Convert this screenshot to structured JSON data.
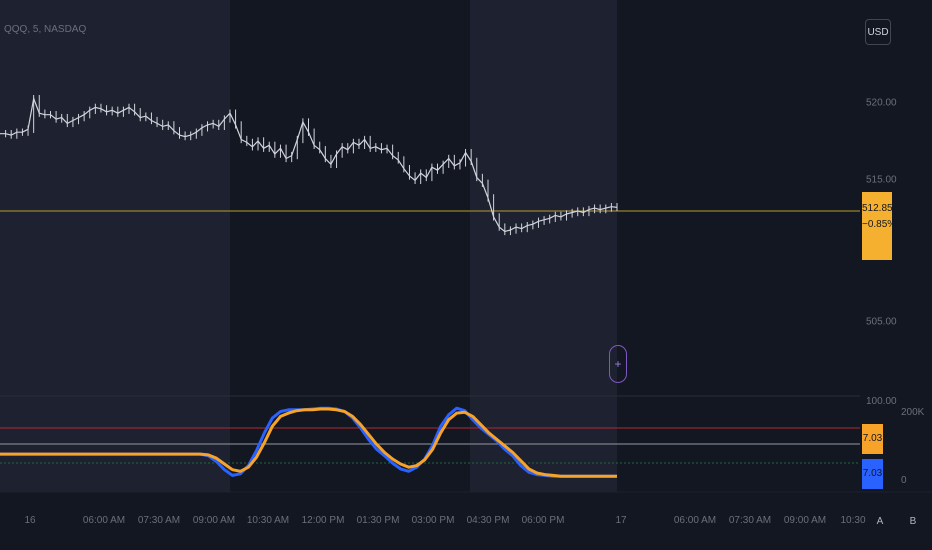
{
  "symbol": {
    "title": "QQQ, 5, NASDAQ"
  },
  "toolbar": {
    "currency": "USD"
  },
  "price_axis": {
    "labels": [
      "520.00",
      "515.00",
      "505.00"
    ],
    "current_price": "512.85",
    "current_change": "−0.85%"
  },
  "oscillator": {
    "axis_top": "100.00",
    "axis_volume": "200K",
    "axis_zero": "0",
    "badge_orange": "7.03",
    "badge_blue": "7.03",
    "colors": {
      "fast": "#2962ff",
      "slow": "#f7a32a",
      "upper": "#b22833",
      "mid": "#9598a1",
      "lower": "#1b6b3a"
    }
  },
  "time_axis": {
    "labels": [
      "16",
      "06:00 AM",
      "07:30 AM",
      "09:00 AM",
      "10:30 AM",
      "12:00 PM",
      "01:30 PM",
      "03:00 PM",
      "04:30 PM",
      "06:00 PM",
      "17",
      "06:00 AM",
      "07:30 AM",
      "09:00 AM",
      "10:30"
    ],
    "btn_a": "A",
    "btn_b": "B"
  },
  "colors": {
    "background": "#131722",
    "session_shade": "#1e2130",
    "price_line": "#b89b2f",
    "candles": "#d1d4dc",
    "badge": "#f5b02f"
  },
  "chart_data": {
    "type": "line",
    "price_series": {
      "name": "QQQ",
      "y_range": [
        502,
        524
      ],
      "values": [
        517.9,
        517.9,
        517.8,
        518.0,
        518.0,
        518.2,
        520.3,
        519.3,
        519.2,
        519.2,
        518.9,
        519.0,
        518.6,
        518.8,
        519.0,
        519.2,
        519.5,
        519.7,
        519.6,
        519.4,
        519.5,
        519.3,
        519.5,
        519.7,
        519.4,
        519.0,
        519.1,
        518.8,
        518.6,
        518.4,
        518.5,
        518.1,
        517.8,
        517.7,
        517.8,
        518.0,
        518.3,
        518.5,
        518.6,
        518.4,
        518.9,
        519.3,
        518.5,
        517.5,
        517.3,
        517.0,
        517.4,
        516.9,
        517.1,
        516.5,
        516.9,
        516.2,
        516.4,
        517.5,
        518.7,
        518.0,
        517.1,
        516.8,
        516.2,
        515.8,
        516.5,
        517.0,
        516.8,
        517.3,
        517.1,
        517.5,
        516.9,
        517.0,
        516.8,
        516.9,
        516.4,
        516.1,
        515.5,
        515.0,
        514.7,
        515.2,
        514.9,
        515.6,
        515.4,
        515.8,
        516.2,
        515.7,
        515.9,
        516.6,
        516.0,
        514.9,
        514.5,
        513.5,
        512.2,
        511.5,
        511.2,
        511.3,
        511.5,
        511.4,
        511.6,
        511.7,
        511.9,
        512.0,
        512.1,
        512.3,
        512.2,
        512.4,
        512.5,
        512.6,
        512.5,
        512.7,
        512.8,
        512.7,
        512.8,
        512.9,
        512.85
      ],
      "current": 512.85,
      "change_pct": -0.85
    },
    "oscillator": {
      "y_range": [
        0,
        100
      ],
      "levels": {
        "upper": 60,
        "mid": 40,
        "lower": 20
      },
      "fast_values": [
        34,
        34,
        34,
        34,
        34,
        34,
        34,
        34,
        34,
        34,
        34,
        34,
        34,
        34,
        34,
        34,
        34,
        34,
        34,
        34,
        34,
        34,
        34,
        34,
        34,
        34,
        32,
        25,
        15,
        8,
        10,
        20,
        38,
        60,
        78,
        86,
        88,
        88,
        88,
        89,
        90,
        90,
        89,
        86,
        78,
        66,
        52,
        40,
        32,
        23,
        16,
        13,
        18,
        28,
        45,
        68,
        82,
        90,
        87,
        76,
        66,
        58,
        50,
        40,
        32,
        20,
        12,
        9,
        8,
        7,
        7,
        7,
        7,
        7,
        7,
        7,
        7,
        7
      ],
      "slow_values": [
        34,
        34,
        34,
        34,
        34,
        34,
        34,
        34,
        34,
        34,
        34,
        34,
        34,
        34,
        34,
        34,
        34,
        34,
        34,
        34,
        34,
        34,
        34,
        34,
        34,
        34,
        33,
        29,
        22,
        15,
        13,
        18,
        30,
        48,
        68,
        80,
        84,
        87,
        88,
        88,
        89,
        89,
        88,
        86,
        80,
        70,
        58,
        46,
        36,
        28,
        22,
        18,
        20,
        27,
        40,
        60,
        76,
        84,
        85,
        80,
        70,
        60,
        52,
        44,
        36,
        26,
        16,
        11,
        9,
        8,
        7,
        7,
        7,
        7,
        7,
        7,
        7,
        7
      ]
    }
  }
}
